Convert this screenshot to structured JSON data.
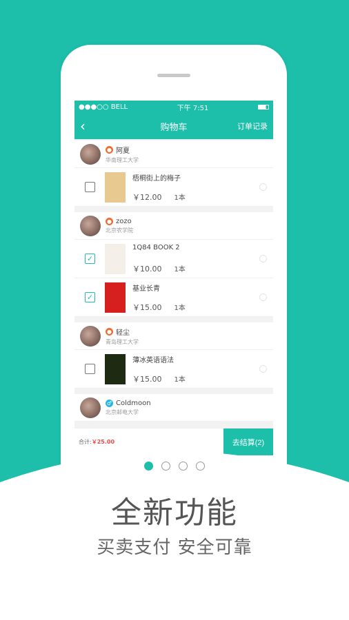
{
  "status_bar": {
    "carrier": "●●●○○ BELL",
    "wifi_icon": "wifi-icon",
    "time": "下午 7:51",
    "battery_icon": "battery-icon"
  },
  "nav": {
    "back_icon": "chevron-left-icon",
    "title": "购物车",
    "orders_label": "订单记录"
  },
  "groups": [
    {
      "seller": "阿夏",
      "gender": "female",
      "school": "华南理工大学",
      "items": [
        {
          "title": "梧桐街上的梅子",
          "price": "￥12.00",
          "qty": "1本",
          "checked": false,
          "cover": "#e8c98f"
        }
      ]
    },
    {
      "seller": "zozo",
      "gender": "female",
      "school": "北京农学院",
      "items": [
        {
          "title": "1Q84 BOOK 2",
          "price": "￥10.00",
          "qty": "1本",
          "checked": true,
          "cover": "#f4efe9"
        },
        {
          "title": "基业长青",
          "price": "￥15.00",
          "qty": "1本",
          "checked": true,
          "cover": "#d62020"
        }
      ]
    },
    {
      "seller": "轻尘",
      "gender": "female",
      "school": "青岛理工大学",
      "items": [
        {
          "title": "薄冰英语语法",
          "price": "￥15.00",
          "qty": "1本",
          "checked": false,
          "cover": "#1f2a12"
        }
      ]
    },
    {
      "seller": "Coldmoon",
      "gender": "male",
      "school": "北京邮电大学",
      "items": []
    }
  ],
  "footer": {
    "total_label": "合计:",
    "total_value": "￥25.00",
    "checkout_label": "去结算(2)"
  },
  "pager": {
    "count": 4,
    "active": 0
  },
  "headline": "全新功能",
  "subline": "买卖支付  安全可靠",
  "colors": {
    "accent": "#1dbfaa",
    "female": "#f26a2e",
    "male": "#27b7e6",
    "price_total": "#e94b4b"
  }
}
